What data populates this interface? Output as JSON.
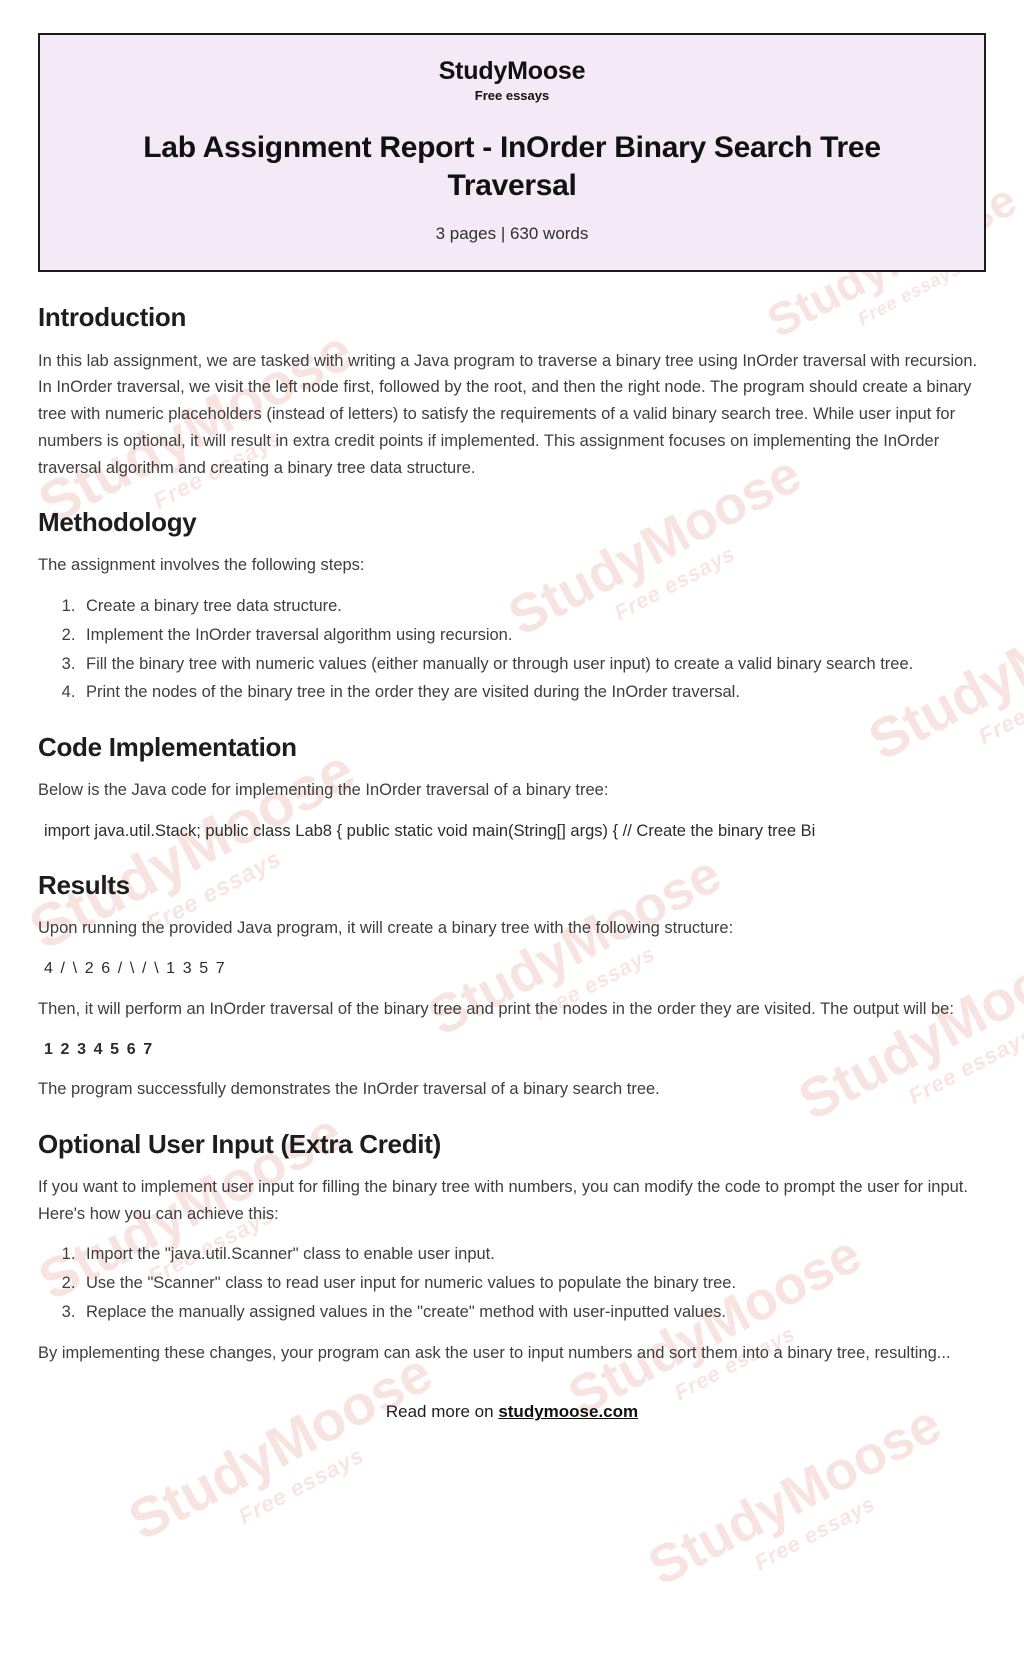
{
  "header": {
    "brand": "StudyMoose",
    "brand_sub": "Free essays",
    "title": "Lab Assignment Report - InOrder Binary Search Tree Traversal",
    "meta": "3 pages | 630 words",
    "background_color": "#f4e9f6",
    "border_color": "#1c1c1c"
  },
  "watermark": {
    "text": "StudyMoose",
    "sub": "Free essays",
    "color": "#e8a79c"
  },
  "sections": {
    "introduction": {
      "heading": "Introduction",
      "paragraph": "In this lab assignment, we are tasked with writing a Java program to traverse a binary tree using InOrder traversal with recursion. In InOrder traversal, we visit the left node first, followed by the root, and then the right node. The program should create a binary tree with numeric placeholders (instead of letters) to satisfy the requirements of a valid binary search tree. While user input for numbers is optional, it will result in extra credit points if implemented. This assignment focuses on implementing the InOrder traversal algorithm and creating a binary tree data structure."
    },
    "methodology": {
      "heading": "Methodology",
      "intro": "The assignment involves the following steps:",
      "steps": [
        "Create a binary tree data structure.",
        "Implement the InOrder traversal algorithm using recursion.",
        "Fill the binary tree with numeric values (either manually or through user input) to create a valid binary search tree.",
        "Print the nodes of the binary tree in the order they are visited during the InOrder traversal."
      ]
    },
    "code_implementation": {
      "heading": "Code Implementation",
      "intro": "Below is the Java code for implementing the InOrder traversal of a binary tree:",
      "code": "import java.util.Stack; public class Lab8 { public static void main(String[] args) { // Create the binary tree Bi"
    },
    "results": {
      "heading": "Results",
      "intro": "Upon running the provided Java program, it will create a binary tree with the following structure:",
      "tree": "4 / \\ 2 6 / \\ / \\ 1 3 5 7",
      "after_tree": "Then, it will perform an InOrder traversal of the binary tree and print the nodes in the order they are visited. The output will be:",
      "output": "1 2 3 4 5 6 7",
      "conclusion": "The program successfully demonstrates the InOrder traversal of a binary search tree."
    },
    "optional_user_input": {
      "heading": "Optional User Input (Extra Credit)",
      "intro": "If you want to implement user input for filling the binary tree with numbers, you can modify the code to prompt the user for input. Here's how you can achieve this:",
      "steps": [
        "Import the \"java.util.Scanner\" class to enable user input.",
        "Use the \"Scanner\" class to read user input for numeric values to populate the binary tree.",
        "Replace the manually assigned values in the \"create\" method with user-inputted values."
      ],
      "closing": "By implementing these changes, your program can ask the user to input numbers and sort them into a binary tree, resulting..."
    }
  },
  "footer": {
    "prefix": "Read more on ",
    "link": "studymoose.com"
  }
}
